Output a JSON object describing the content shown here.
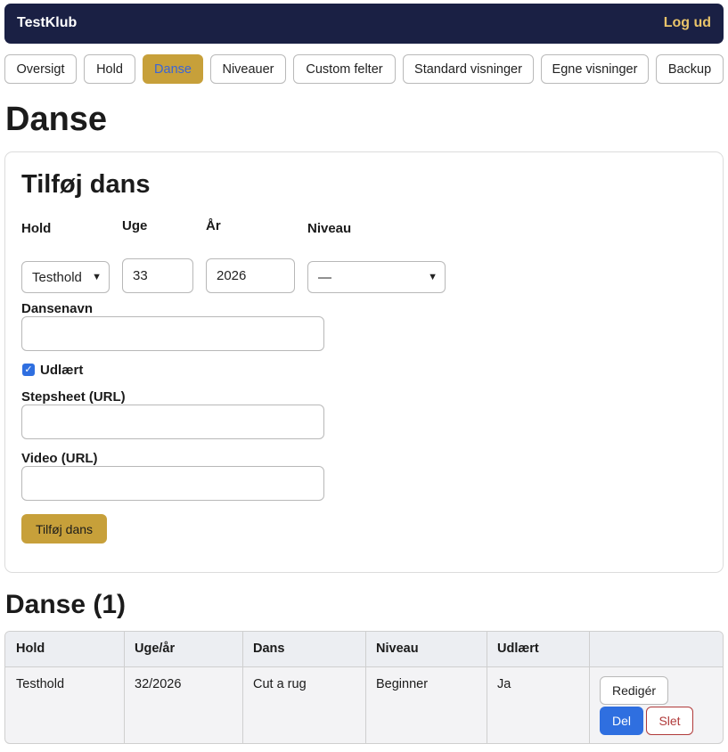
{
  "header": {
    "brand": "TestKlub",
    "logout": "Log ud"
  },
  "nav": {
    "tabs": [
      {
        "label": "Oversigt"
      },
      {
        "label": "Hold"
      },
      {
        "label": "Danse"
      },
      {
        "label": "Niveauer"
      },
      {
        "label": "Custom felter"
      },
      {
        "label": "Standard visninger"
      },
      {
        "label": "Egne visninger"
      },
      {
        "label": "Backup"
      }
    ],
    "active": "Danse"
  },
  "page": {
    "title": "Danse"
  },
  "form": {
    "title": "Tilføj dans",
    "hold_label": "Hold",
    "hold_value": "Testhold",
    "week_label": "Uge",
    "week_value": "33",
    "year_label": "År",
    "year_value": "2026",
    "level_label": "Niveau",
    "level_value": "—",
    "dance_name_label": "Dansenavn",
    "dance_name_value": "",
    "learned_label": "Udlært",
    "learned_checked": true,
    "stepsheet_label": "Stepsheet (URL)",
    "stepsheet_value": "",
    "video_label": "Video (URL)",
    "video_value": "",
    "submit_label": "Tilføj dans"
  },
  "list": {
    "title": "Danse (1)",
    "columns": [
      "Hold",
      "Uge/år",
      "Dans",
      "Niveau",
      "Udlært",
      ""
    ],
    "rows": [
      {
        "hold": "Testhold",
        "week_year": "32/2026",
        "dance": "Cut a rug",
        "level": "Beginner",
        "learned": "Ja",
        "edit_label": "Redigér",
        "share_label": "Del",
        "delete_label": "Slet"
      }
    ]
  },
  "colors": {
    "header_bg": "#1a2044",
    "accent_gold": "#c7a03a",
    "logout_text": "#e9c46a",
    "primary_blue": "#2f6fe0",
    "danger_red": "#b03a3a"
  }
}
